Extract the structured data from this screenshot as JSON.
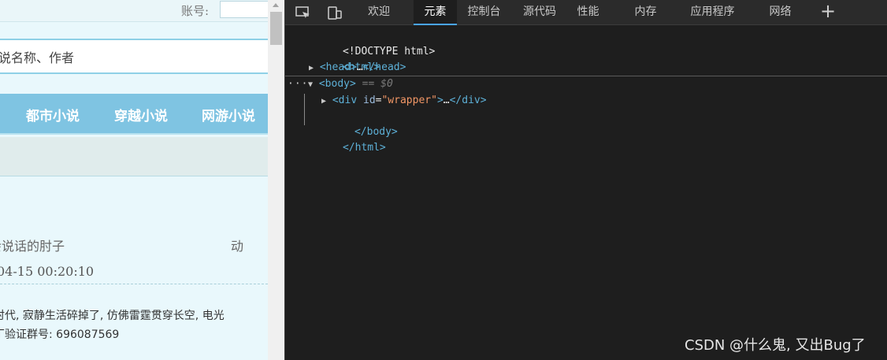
{
  "webpage": {
    "account_label": "账号:",
    "search_placeholder": "说名称、作者",
    "nav_items": [
      "都市小说",
      "穿越小说",
      "网游小说"
    ],
    "author_text": "会说话的肘子",
    "side_char": "动",
    "datetime": "04-15 00:20:10",
    "desc_line1": "时代, 寂静生活碎掉了, 仿佛雷霆贯穿长空, 电光",
    "desc_line2": "丁验证群号: 696087569"
  },
  "devtools": {
    "tabs": [
      "欢迎",
      "元素",
      "控制台",
      "源代码",
      "性能",
      "内存",
      "应用程序",
      "网络"
    ],
    "active_tab": "元素",
    "dom": {
      "doctype": "<!DOCTYPE html>",
      "html_open": "<html>",
      "head_open": "<head>",
      "head_ellipsis": "…",
      "head_close": "</head>",
      "body_open": "<body>",
      "body_eq": "== $0",
      "div_open": "<div",
      "div_attr_name": "id",
      "div_attr_value": "\"wrapper\"",
      "div_close_bracket": ">",
      "div_ellipsis": "…",
      "div_close": "</div>",
      "body_close": "</body>",
      "html_close": "</html>",
      "row_dots": "···"
    },
    "icons": [
      "inspect-element-icon",
      "device-emulation-icon",
      "add-tab-icon"
    ]
  },
  "watermark": "CSDN @什么鬼, 又出Bug了"
}
